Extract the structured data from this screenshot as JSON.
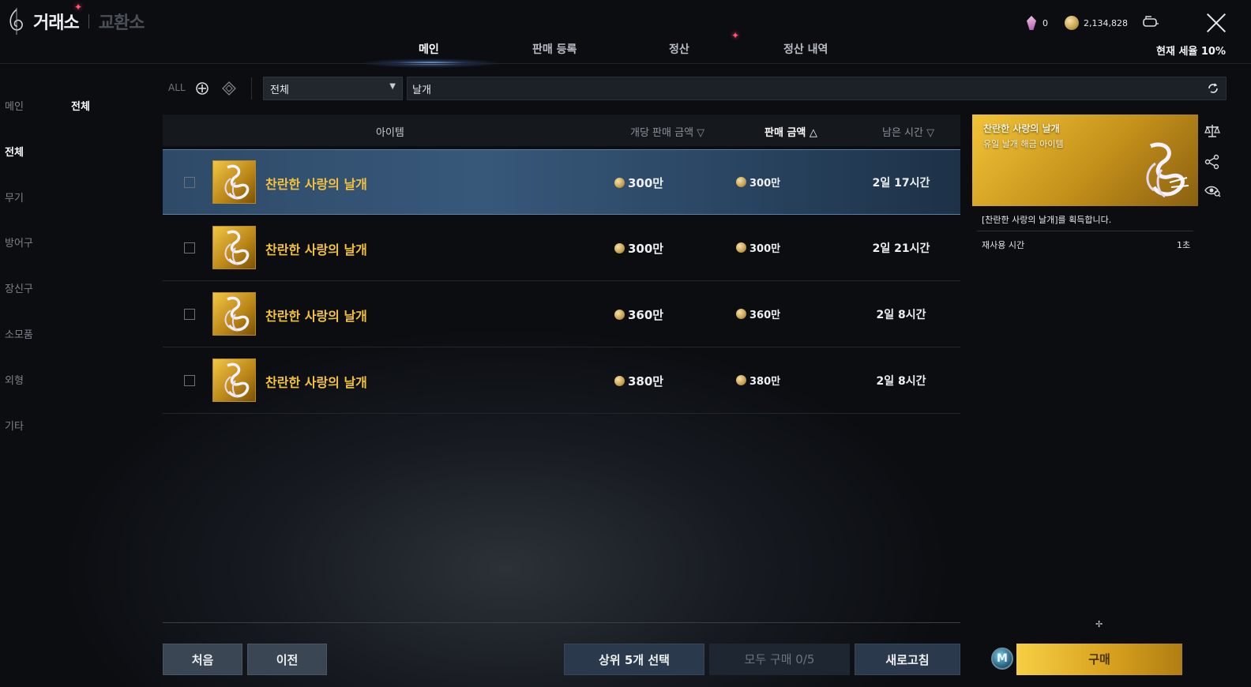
{
  "header": {
    "title": "거래소",
    "subtitle": "교환소",
    "tabs": [
      {
        "label": "메인",
        "active": true
      },
      {
        "label": "판매 등록",
        "active": false
      },
      {
        "label": "정산",
        "active": false
      },
      {
        "label": "정산 내역",
        "active": false
      }
    ],
    "currencies": {
      "crystal": "0",
      "gold": "2,134,828"
    },
    "tax_label": "현재 세율 10%"
  },
  "sidebar": {
    "items": [
      {
        "label": "메인",
        "active": false
      },
      {
        "label": "전체",
        "active": true
      },
      {
        "label": "무기",
        "active": false
      },
      {
        "label": "방어구",
        "active": false
      },
      {
        "label": "장신구",
        "active": false
      },
      {
        "label": "소모품",
        "active": false
      },
      {
        "label": "외형",
        "active": false
      },
      {
        "label": "기타",
        "active": false
      }
    ],
    "sub_selected": "전체"
  },
  "filter": {
    "all_label": "ALL",
    "dropdown_value": "전체",
    "search_value": "날개"
  },
  "table": {
    "headers": {
      "item": "아이템",
      "unit_price": "개당 판매 금액",
      "price": "판매 금액",
      "remaining": "남은 시간"
    },
    "rows": [
      {
        "name": "찬란한 사랑의 날개",
        "unit_price": "300만",
        "price": "300만",
        "remaining": "2일 17시간",
        "selected": true
      },
      {
        "name": "찬란한 사랑의 날개",
        "unit_price": "300만",
        "price": "300만",
        "remaining": "2일 21시간",
        "selected": false
      },
      {
        "name": "찬란한 사랑의 날개",
        "unit_price": "360만",
        "price": "360만",
        "remaining": "2일 8시간",
        "selected": false
      },
      {
        "name": "찬란한 사랑의 날개",
        "unit_price": "380만",
        "price": "380만",
        "remaining": "2일 8시간",
        "selected": false
      }
    ]
  },
  "detail": {
    "title": "찬란한 사랑의 날개",
    "subtitle": "유일 날개 해금 아이템",
    "description": "[찬란한 사랑의 날개]를 획득합니다.",
    "cooldown_label": "재사용 시간",
    "cooldown_value": "1초"
  },
  "buttons": {
    "first": "처음",
    "prev": "이전",
    "select_top5": "상위 5개 선택",
    "buy_all": "모두 구매 0/5",
    "refresh": "새로고침",
    "buy": "구매"
  },
  "colors": {
    "accent_gold": "#f3c23e",
    "selected_row": "#38587a",
    "buy_button": "#f6cf45"
  }
}
